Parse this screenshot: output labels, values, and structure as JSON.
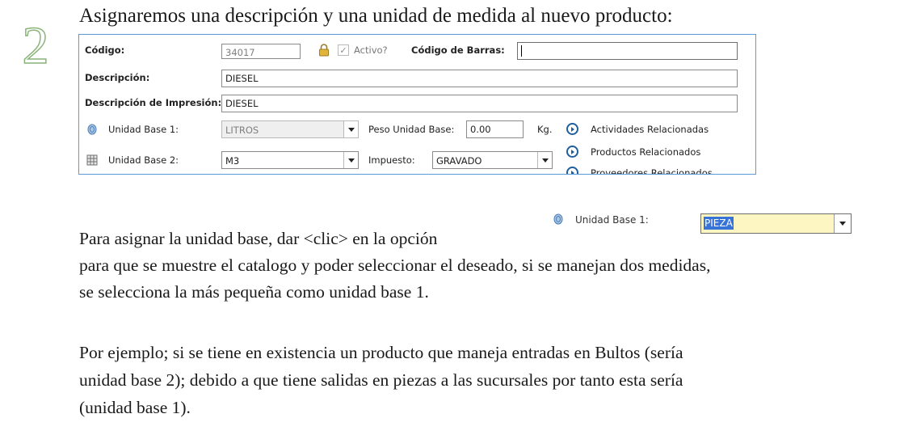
{
  "step_number": "2",
  "heading": "Asignaremos una descripción y una unidad de medida al nuevo producto:",
  "form": {
    "codigo_label": "Código:",
    "codigo_value": "34017",
    "activo_label": "Activo?",
    "activo_checked": true,
    "codigo_barras_label": "Código de Barras:",
    "codigo_barras_value": "",
    "descripcion_label": "Descripción:",
    "descripcion_value": "DIESEL",
    "descripcion_impresion_label": "Descripción de Impresión:",
    "descripcion_impresion_value": "DIESEL",
    "unidad_base1_label": "Unidad Base 1:",
    "unidad_base1_value": "LITROS",
    "peso_label": "Peso Unidad Base:",
    "peso_value": "0.00",
    "peso_unit": "Kg.",
    "unidad_base2_label": "Unidad Base 2:",
    "unidad_base2_value": "M3",
    "impuesto_label": "Impuesto:",
    "impuesto_value": "GRAVADO",
    "links": [
      "Actividades Relacionadas",
      "Productos Relacionados",
      "Proveedores Relacionados"
    ]
  },
  "inline_widget": {
    "label": "Unidad Base 1:",
    "value": "PIEZA"
  },
  "paragraph1": [
    "Para asignar la unidad base, dar <clic> en  la opción",
    "para que se muestre el catalogo y poder seleccionar el deseado, si se manejan dos medidas,",
    "se selecciona la más pequeña como unidad base 1."
  ],
  "paragraph2": [
    "Por ejemplo; si se tiene en existencia un producto que maneja entradas en Bultos (sería",
    "unidad base 2); debido a que tiene salidas en piezas a las sucursales por tanto esta sería",
    "(unidad base 1)."
  ],
  "colors": {
    "form_border": "#5b9bd5",
    "link_icon": "#1f5f9e",
    "highlight_input": "#fdf6c3",
    "selection": "#3874d8",
    "step_outline": "#8bb37a"
  }
}
